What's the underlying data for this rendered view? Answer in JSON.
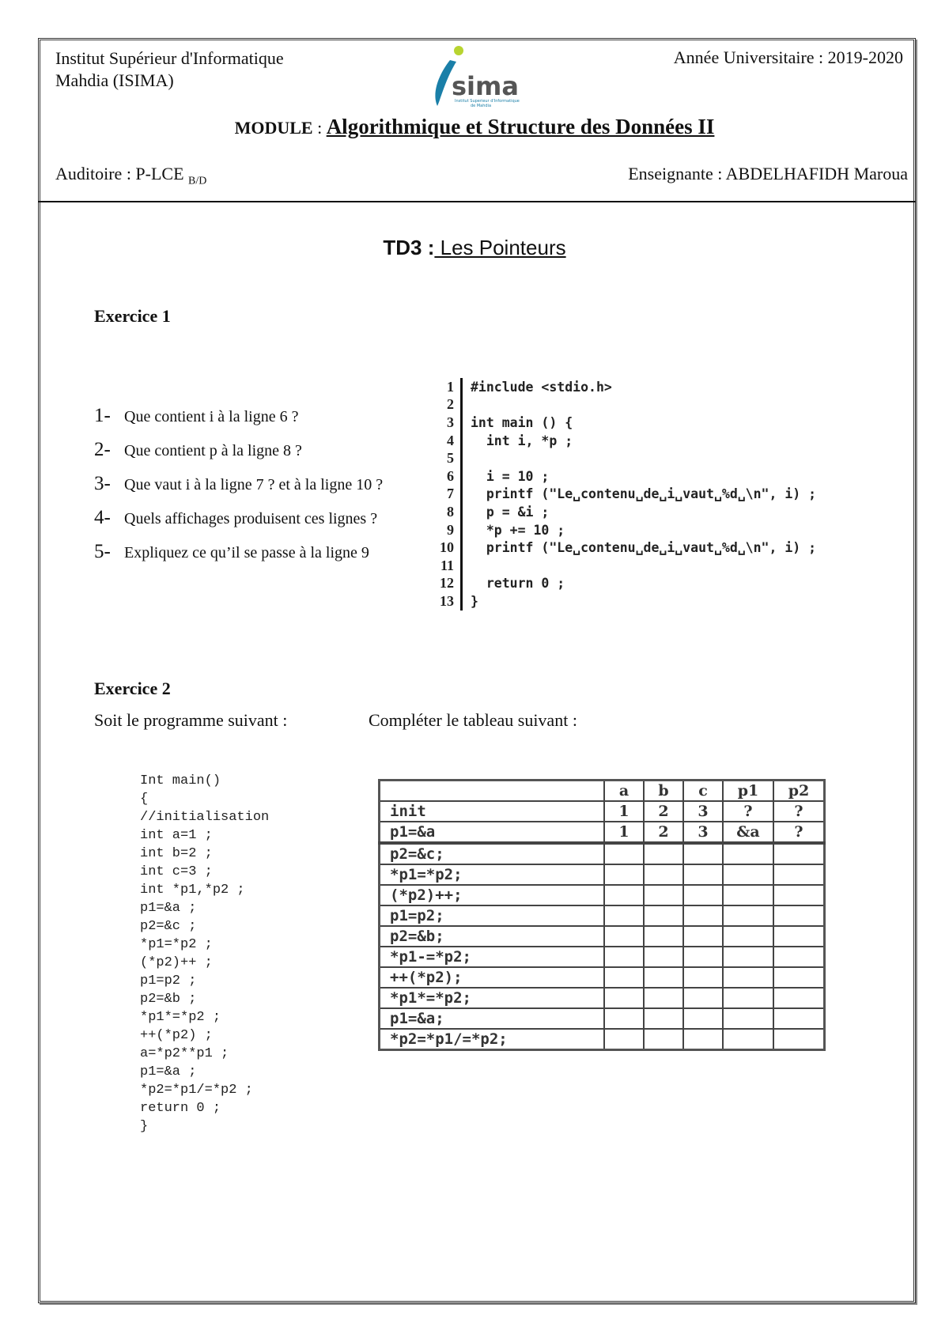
{
  "header": {
    "institute_line1": "Institut Supérieur d'Informatique",
    "institute_line2": "Mahdia (ISIMA)",
    "academic_year": "Année Universitaire : 2019-2020",
    "logo_text": "sima",
    "logo_subtitle_1": "Institut Superieur d'Informatique",
    "logo_subtitle_2": "de Mahdia",
    "module_label": "MODULE",
    "module_sep": " : ",
    "module_name": "Algorithmique et Structure des Données II",
    "audience_label": "Auditoire : P-LCE ",
    "audience_sub": "B/D",
    "teacher": "Enseignante : ABDELHAFIDH Maroua"
  },
  "title": {
    "number": "TD3 :",
    "topic": " Les Pointeurs"
  },
  "exercise1": {
    "heading": "Exercice 1",
    "questions": [
      {
        "num": "1-",
        "text": "Que contient i à la ligne 6 ?"
      },
      {
        "num": "2-",
        "text": "Que contient p à la ligne 8 ?"
      },
      {
        "num": "3-",
        "text": "Que vaut i à la ligne 7 ? et à la ligne 10 ?"
      },
      {
        "num": "4-",
        "text": "Quels affichages produisent ces lignes ?"
      },
      {
        "num": "5-",
        "text": "Expliquez ce qu’il se passe à la ligne 9"
      }
    ],
    "code": [
      {
        "ln": "1",
        "text": "#include <stdio.h>"
      },
      {
        "ln": "2",
        "text": ""
      },
      {
        "ln": "3",
        "text": "int main () {"
      },
      {
        "ln": "4",
        "text": "  int i, *p ;"
      },
      {
        "ln": "5",
        "text": ""
      },
      {
        "ln": "6",
        "text": "  i = 10 ;"
      },
      {
        "ln": "7",
        "text": "  printf (\"Le␣contenu␣de␣i␣vaut␣%d␣\\n\", i) ;"
      },
      {
        "ln": "8",
        "text": "  p = &i ;"
      },
      {
        "ln": "9",
        "text": "  *p += 10 ;"
      },
      {
        "ln": "10",
        "text": "  printf (\"Le␣contenu␣de␣i␣vaut␣%d␣\\n\", i) ;"
      },
      {
        "ln": "11",
        "text": ""
      },
      {
        "ln": "12",
        "text": "  return 0 ;"
      },
      {
        "ln": "13",
        "text": "}"
      }
    ]
  },
  "exercise2": {
    "heading": "Exercice 2",
    "intro_left": "Soit le programme suivant :",
    "intro_right": "Compléter le tableau suivant :",
    "program": [
      "Int main()",
      "{",
      "//initialisation",
      "int a=1 ;",
      "int b=2 ;",
      "int c=3 ;",
      "int *p1,*p2 ;",
      "p1=&a ;",
      "p2=&c ;",
      "*p1=*p2 ;",
      "(*p2)++ ;",
      "p1=p2 ;",
      "p2=&b ;",
      "*p1*=*p2 ;",
      "++(*p2) ;",
      "a=*p2**p1 ;",
      "p1=&a ;",
      "*p2=*p1/=*p2 ;",
      "return 0 ;",
      "}"
    ],
    "table": {
      "columns": [
        "",
        "a",
        "b",
        "c",
        "p1",
        "p2"
      ],
      "rows": [
        [
          "init",
          "1",
          "2",
          "3",
          "?",
          "?"
        ],
        [
          "p1=&a",
          "1",
          "2",
          "3",
          "&a",
          "?"
        ],
        [
          "p2=&c;",
          "",
          "",
          "",
          "",
          ""
        ],
        [
          "*p1=*p2;",
          "",
          "",
          "",
          "",
          ""
        ],
        [
          "(*p2)++;",
          "",
          "",
          "",
          "",
          ""
        ],
        [
          "p1=p2;",
          "",
          "",
          "",
          "",
          ""
        ],
        [
          "p2=&b;",
          "",
          "",
          "",
          "",
          ""
        ],
        [
          "*p1-=*p2;",
          "",
          "",
          "",
          "",
          ""
        ],
        [
          "++(*p2);",
          "",
          "",
          "",
          "",
          ""
        ],
        [
          "*p1*=*p2;",
          "",
          "",
          "",
          "",
          ""
        ],
        [
          "p1=&a;",
          "",
          "",
          "",
          "",
          ""
        ],
        [
          "*p2=*p1/=*p2;",
          "",
          "",
          "",
          "",
          ""
        ]
      ]
    }
  },
  "colors": {
    "logo_blue": "#1a7fa8",
    "logo_green": "#b8d430",
    "logo_gray": "#555555"
  }
}
